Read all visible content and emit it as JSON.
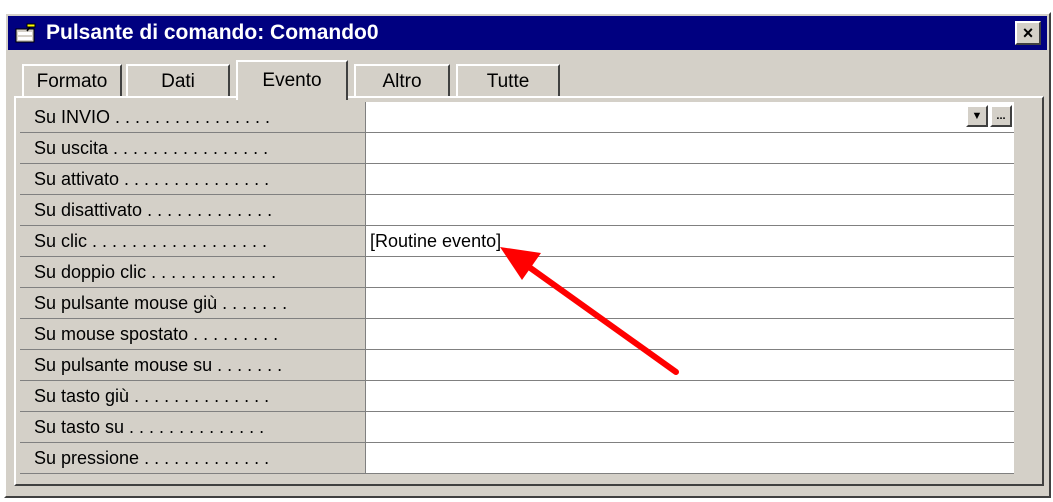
{
  "window": {
    "title": "Pulsante di comando: Comando0",
    "close_glyph": "×",
    "title_icon": "command-button-properties-icon"
  },
  "tabs": [
    {
      "label": "Formato",
      "active": false
    },
    {
      "label": "Dati",
      "active": false
    },
    {
      "label": "Evento",
      "active": true
    },
    {
      "label": "Altro",
      "active": false
    },
    {
      "label": "Tutte",
      "active": false
    }
  ],
  "properties": [
    {
      "label": "Su INVIO . . . . . . . . . . . . . . . .",
      "value": ""
    },
    {
      "label": "Su uscita . . . . . . . . . . . . . . . .",
      "value": ""
    },
    {
      "label": "Su attivato . . . . . . . . . . . . . . .",
      "value": ""
    },
    {
      "label": "Su disattivato . . . . . . . . . . . . .",
      "value": ""
    },
    {
      "label": "Su clic . . . . . . . . . . . . . . . . . .",
      "value": "[Routine evento]"
    },
    {
      "label": "Su doppio clic . . . . . . . . . . . . .",
      "value": ""
    },
    {
      "label": "Su pulsante mouse giù . . . . . . .",
      "value": ""
    },
    {
      "label": "Su mouse spostato . . . . . . . . .",
      "value": ""
    },
    {
      "label": "Su pulsante mouse su . . . . . . .",
      "value": ""
    },
    {
      "label": "Su tasto giù . . . . . . . . . . . . . .",
      "value": ""
    },
    {
      "label": "Su tasto su . . . . . . . . . . . . . .",
      "value": ""
    },
    {
      "label": "Su pressione . . . . . . . . . . . . .",
      "value": ""
    }
  ],
  "row_buttons": {
    "dropdown_glyph": "▼",
    "builder_glyph": "..."
  },
  "colors": {
    "titlebar": "#000080",
    "face": "#d4d0c8",
    "annotation_arrow": "#ff0000"
  }
}
